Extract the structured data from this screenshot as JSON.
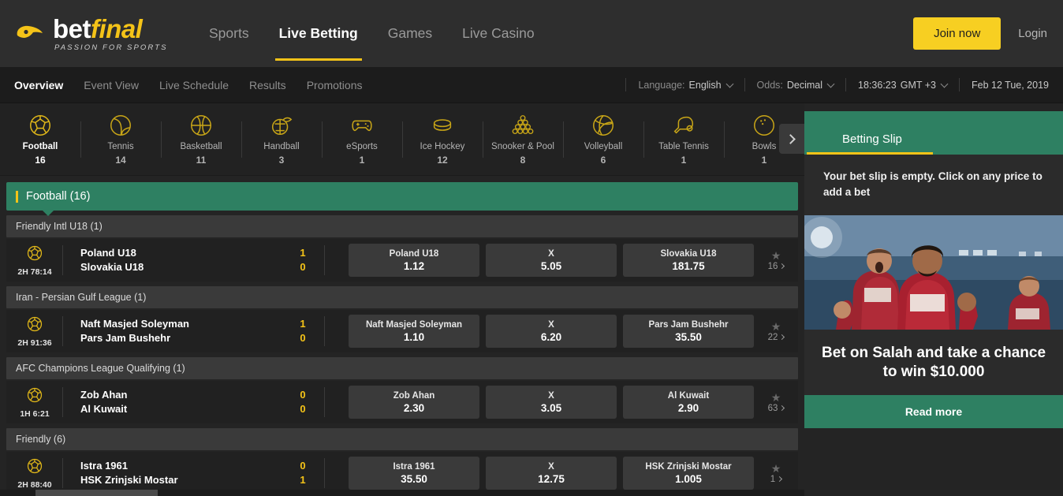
{
  "brand": {
    "name_part1": "bet",
    "name_part2": "final",
    "tagline": "PASSION FOR SPORTS",
    "logo_icon": "betfinal-swoosh-icon",
    "accent_yellow": "#f4c318",
    "accent_green": "#2e8062"
  },
  "header": {
    "nav": [
      {
        "label": "Sports",
        "active": false
      },
      {
        "label": "Live Betting",
        "active": true
      },
      {
        "label": "Games",
        "active": false
      },
      {
        "label": "Live Casino",
        "active": false
      }
    ],
    "join_label": "Join now",
    "login_label": "Login"
  },
  "subnav": {
    "items": [
      {
        "label": "Overview",
        "active": true
      },
      {
        "label": "Event View",
        "active": false
      },
      {
        "label": "Live Schedule",
        "active": false
      },
      {
        "label": "Results",
        "active": false
      },
      {
        "label": "Promotions",
        "active": false
      }
    ],
    "meta": {
      "language_label": "Language:",
      "language_value": "English",
      "odds_label": "Odds:",
      "odds_value": "Decimal",
      "clock_time": "18:36:23",
      "clock_zone": "GMT +3",
      "date": "Feb 12 Tue, 2019"
    }
  },
  "sports": [
    {
      "name": "Football",
      "count": "16",
      "icon": "football-icon",
      "active": true
    },
    {
      "name": "Tennis",
      "count": "14",
      "icon": "tennis-icon",
      "active": false
    },
    {
      "name": "Basketball",
      "count": "11",
      "icon": "basketball-icon",
      "active": false
    },
    {
      "name": "Handball",
      "count": "3",
      "icon": "handball-icon",
      "active": false
    },
    {
      "name": "eSports",
      "count": "1",
      "icon": "esports-icon",
      "active": false
    },
    {
      "name": "Ice Hockey",
      "count": "12",
      "icon": "ice-hockey-icon",
      "active": false
    },
    {
      "name": "Snooker & Pool",
      "count": "8",
      "icon": "snooker-icon",
      "active": false
    },
    {
      "name": "Volleyball",
      "count": "6",
      "icon": "volleyball-icon",
      "active": false
    },
    {
      "name": "Table Tennis",
      "count": "1",
      "icon": "table-tennis-icon",
      "active": false
    },
    {
      "name": "Bowls",
      "count": "1",
      "icon": "bowls-icon",
      "active": false
    }
  ],
  "sport_banner": "Football (16)",
  "leagues": [
    {
      "title": "Friendly Intl U18 (1)",
      "matches": [
        {
          "period": "2H 78:14",
          "home": "Poland U18",
          "away": "Slovakia U18",
          "home_score": "1",
          "away_score": "0",
          "odds": [
            {
              "label": "Poland U18",
              "value": "1.12"
            },
            {
              "label": "X",
              "value": "5.05"
            },
            {
              "label": "Slovakia U18",
              "value": "181.75"
            }
          ],
          "more_count": "16"
        }
      ]
    },
    {
      "title": "Iran - Persian Gulf League (1)",
      "matches": [
        {
          "period": "2H 91:36",
          "home": "Naft Masjed Soleyman",
          "away": "Pars Jam Bushehr",
          "home_score": "1",
          "away_score": "0",
          "odds": [
            {
              "label": "Naft Masjed Soleyman",
              "value": "1.10"
            },
            {
              "label": "X",
              "value": "6.20"
            },
            {
              "label": "Pars Jam Bushehr",
              "value": "35.50"
            }
          ],
          "more_count": "22"
        }
      ]
    },
    {
      "title": "AFC Champions League Qualifying (1)",
      "matches": [
        {
          "period": "1H 6:21",
          "home": "Zob Ahan",
          "away": "Al Kuwait",
          "home_score": "0",
          "away_score": "0",
          "odds": [
            {
              "label": "Zob Ahan",
              "value": "2.30"
            },
            {
              "label": "X",
              "value": "3.05"
            },
            {
              "label": "Al Kuwait",
              "value": "2.90"
            }
          ],
          "more_count": "63"
        }
      ]
    },
    {
      "title": "Friendly (6)",
      "matches": [
        {
          "period": "2H 88:40",
          "home": "Istra 1961",
          "away": "HSK Zrinjski Mostar",
          "home_score": "0",
          "away_score": "1",
          "odds": [
            {
              "label": "Istra 1961",
              "value": "35.50"
            },
            {
              "label": "X",
              "value": "12.75"
            },
            {
              "label": "HSK Zrinjski Mostar",
              "value": "1.005"
            }
          ],
          "more_count": "1"
        }
      ]
    }
  ],
  "betting_slip": {
    "title": "Betting Slip",
    "empty_message": "Your bet slip is empty. Click on any price to add a bet"
  },
  "promo": {
    "image_alt": "liverpool-players-celebrating",
    "headline": "Bet on Salah and take a chance to win $10.000",
    "cta_label": "Read more"
  }
}
